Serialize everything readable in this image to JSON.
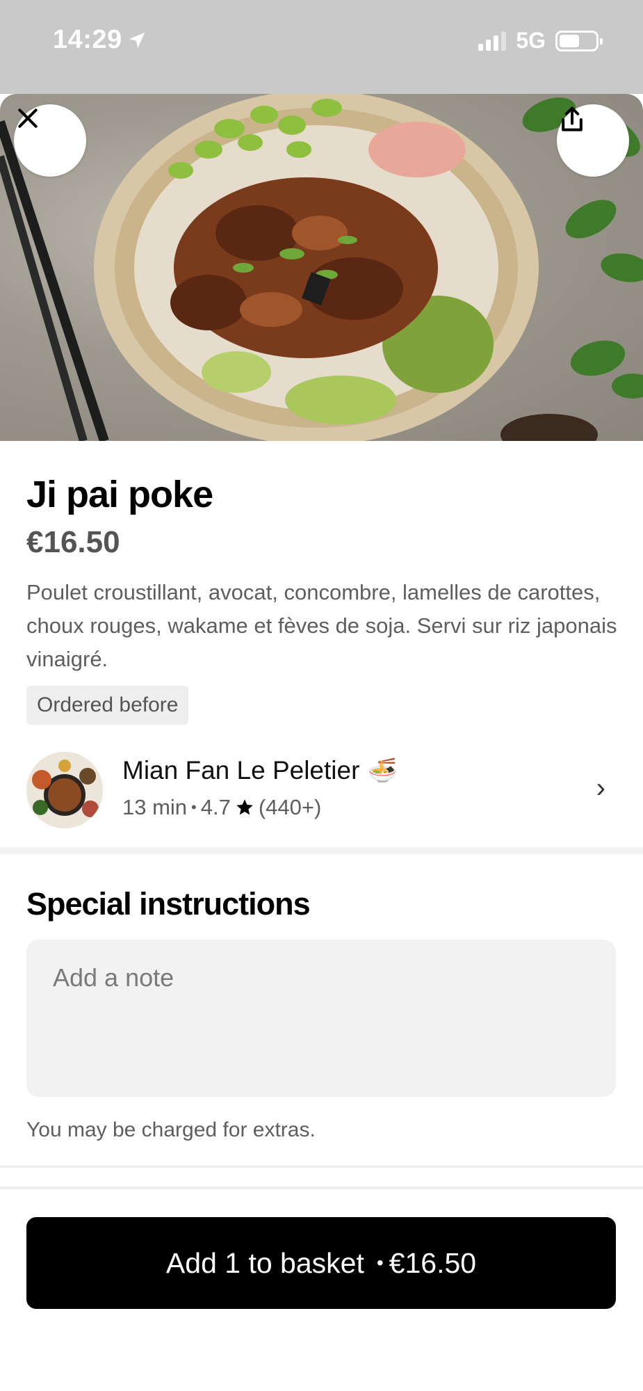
{
  "status_bar": {
    "time": "14:29",
    "network": "5G",
    "signal_bars": 3,
    "battery_level": 0.55
  },
  "hero": {
    "close_icon": "close-icon",
    "share_icon": "share-icon"
  },
  "item": {
    "title": "Ji pai poke",
    "price": "€16.50",
    "description": "Poulet croustillant, avocat, concombre, lamelles de carottes, choux rouges, wakame et fèves de soja. Servi sur riz japonais vinaigré.",
    "badge": "Ordered before"
  },
  "store": {
    "name": "Mian Fan Le Peletier",
    "emoji": "🍜",
    "time": "13 min",
    "separator": "•",
    "rating": "4.7",
    "reviews": "(440+)",
    "chevron": "›"
  },
  "special_instructions": {
    "title": "Special instructions",
    "placeholder": "Add a note",
    "hint": "You may be charged for extras."
  },
  "cta": {
    "label": "Add 1 to basket",
    "separator": "•",
    "price": "€16.50"
  },
  "colors": {
    "status_bar_bg": "#c9c9c9",
    "cta_bg": "#000000",
    "badge_bg": "#eeeeee",
    "note_bg": "#f2f2f2"
  }
}
